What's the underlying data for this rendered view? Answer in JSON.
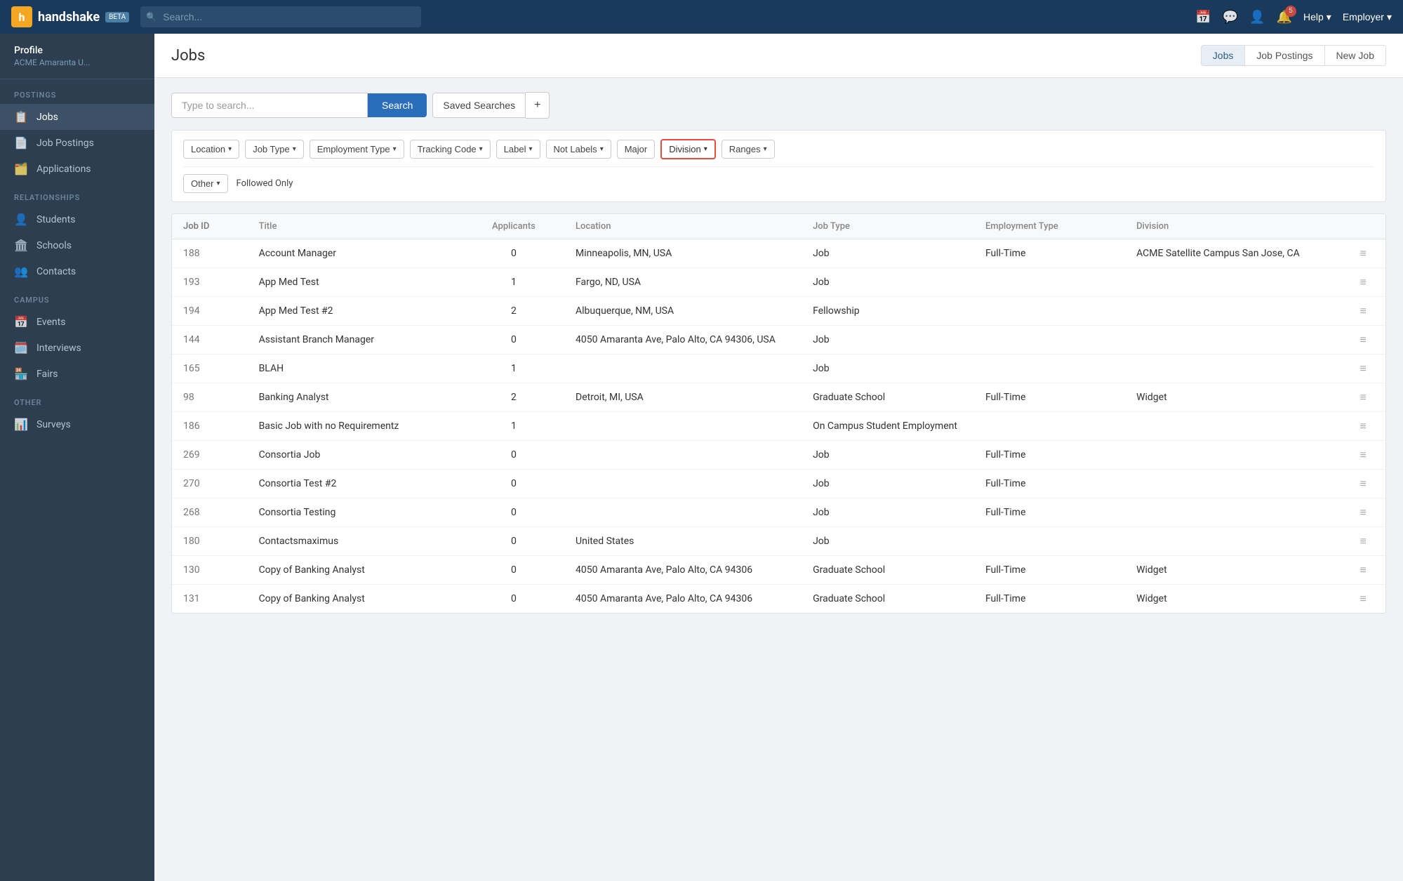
{
  "topnav": {
    "logo_letter": "h",
    "brand": "handshake",
    "beta": "BETA",
    "search_placeholder": "Search...",
    "help_label": "Help",
    "employer_label": "Employer",
    "notification_count": "5"
  },
  "sidebar": {
    "user": {
      "name": "Profile",
      "org": "ACME Amaranta U..."
    },
    "sections": [
      {
        "label": "POSTINGS",
        "items": [
          {
            "id": "jobs",
            "label": "Jobs",
            "icon": "📋",
            "active": true
          },
          {
            "id": "job-postings",
            "label": "Job Postings",
            "icon": "📄"
          },
          {
            "id": "applications",
            "label": "Applications",
            "icon": "🗂️"
          }
        ]
      },
      {
        "label": "RELATIONSHIPS",
        "items": [
          {
            "id": "students",
            "label": "Students",
            "icon": "👤"
          },
          {
            "id": "schools",
            "label": "Schools",
            "icon": "🏛️"
          },
          {
            "id": "contacts",
            "label": "Contacts",
            "icon": "👥"
          }
        ]
      },
      {
        "label": "CAMPUS",
        "items": [
          {
            "id": "events",
            "label": "Events",
            "icon": "📅"
          },
          {
            "id": "interviews",
            "label": "Interviews",
            "icon": "🗓️"
          },
          {
            "id": "fairs",
            "label": "Fairs",
            "icon": "🏪"
          }
        ]
      },
      {
        "label": "OTHER",
        "items": [
          {
            "id": "surveys",
            "label": "Surveys",
            "icon": "📊"
          }
        ]
      }
    ]
  },
  "main": {
    "title": "Jobs",
    "tabs": [
      {
        "id": "jobs",
        "label": "Jobs",
        "active": true
      },
      {
        "id": "job-postings",
        "label": "Job Postings"
      },
      {
        "id": "new-job",
        "label": "New Job"
      }
    ]
  },
  "search": {
    "placeholder": "Type to search...",
    "search_button": "Search",
    "saved_searches_button": "Saved Searches",
    "plus_button": "+"
  },
  "filters": {
    "items": [
      {
        "id": "location",
        "label": "Location",
        "highlighted": false
      },
      {
        "id": "job-type",
        "label": "Job Type",
        "highlighted": false
      },
      {
        "id": "employment-type",
        "label": "Employment Type",
        "highlighted": false
      },
      {
        "id": "tracking-code",
        "label": "Tracking Code",
        "highlighted": false
      },
      {
        "id": "label",
        "label": "Label",
        "highlighted": false
      },
      {
        "id": "not-labels",
        "label": "Not Labels",
        "highlighted": false
      },
      {
        "id": "major",
        "label": "Major",
        "highlighted": false
      },
      {
        "id": "division",
        "label": "Division",
        "highlighted": true
      },
      {
        "id": "ranges",
        "label": "Ranges",
        "highlighted": false
      }
    ],
    "row2": [
      {
        "id": "other",
        "label": "Other",
        "highlighted": false
      },
      {
        "id": "followed-only",
        "label": "Followed Only",
        "static": true
      }
    ]
  },
  "table": {
    "columns": [
      {
        "id": "job-id",
        "label": "Job ID"
      },
      {
        "id": "title",
        "label": "Title"
      },
      {
        "id": "applicants",
        "label": "Applicants"
      },
      {
        "id": "location",
        "label": "Location"
      },
      {
        "id": "job-type",
        "label": "Job Type"
      },
      {
        "id": "employment-type",
        "label": "Employment Type"
      },
      {
        "id": "division",
        "label": "Division"
      },
      {
        "id": "menu",
        "label": ""
      }
    ],
    "rows": [
      {
        "id": "188",
        "title": "Account Manager",
        "applicants": "0",
        "location": "Minneapolis, MN, USA",
        "job_type": "Job",
        "employment_type": "Full-Time",
        "division": "ACME Satellite Campus San Jose, CA",
        "menu": "≡"
      },
      {
        "id": "193",
        "title": "App Med Test",
        "applicants": "1",
        "location": "Fargo, ND, USA",
        "job_type": "Job",
        "employment_type": "",
        "division": "",
        "menu": "≡"
      },
      {
        "id": "194",
        "title": "App Med Test #2",
        "applicants": "2",
        "location": "Albuquerque, NM, USA",
        "job_type": "Fellowship",
        "employment_type": "",
        "division": "",
        "menu": "≡"
      },
      {
        "id": "144",
        "title": "Assistant Branch Manager",
        "applicants": "0",
        "location": "4050 Amaranta Ave, Palo Alto, CA 94306, USA",
        "job_type": "Job",
        "employment_type": "",
        "division": "",
        "menu": "≡"
      },
      {
        "id": "165",
        "title": "BLAH",
        "applicants": "1",
        "location": "",
        "job_type": "Job",
        "employment_type": "",
        "division": "",
        "menu": "≡"
      },
      {
        "id": "98",
        "title": "Banking Analyst",
        "applicants": "2",
        "location": "Detroit, MI, USA",
        "job_type": "Graduate School",
        "employment_type": "Full-Time",
        "division": "Widget",
        "menu": "≡"
      },
      {
        "id": "186",
        "title": "Basic Job with no Requirementz",
        "applicants": "1",
        "location": "",
        "job_type": "On Campus Student Employment",
        "employment_type": "",
        "division": "",
        "menu": "≡"
      },
      {
        "id": "269",
        "title": "Consortia Job",
        "applicants": "0",
        "location": "",
        "job_type": "Job",
        "employment_type": "Full-Time",
        "division": "",
        "menu": "≡"
      },
      {
        "id": "270",
        "title": "Consortia Test #2",
        "applicants": "0",
        "location": "",
        "job_type": "Job",
        "employment_type": "Full-Time",
        "division": "",
        "menu": "≡"
      },
      {
        "id": "268",
        "title": "Consortia Testing",
        "applicants": "0",
        "location": "",
        "job_type": "Job",
        "employment_type": "Full-Time",
        "division": "",
        "menu": "≡"
      },
      {
        "id": "180",
        "title": "Contactsmaximus",
        "applicants": "0",
        "location": "United States",
        "job_type": "Job",
        "employment_type": "",
        "division": "",
        "menu": "≡"
      },
      {
        "id": "130",
        "title": "Copy of Banking Analyst",
        "applicants": "0",
        "location": "4050 Amaranta Ave, Palo Alto, CA 94306",
        "job_type": "Graduate School",
        "employment_type": "Full-Time",
        "division": "Widget",
        "menu": "≡"
      },
      {
        "id": "131",
        "title": "Copy of Banking Analyst",
        "applicants": "0",
        "location": "4050 Amaranta Ave, Palo Alto, CA 94306",
        "job_type": "Graduate School",
        "employment_type": "Full-Time",
        "division": "Widget",
        "menu": "≡"
      }
    ]
  }
}
